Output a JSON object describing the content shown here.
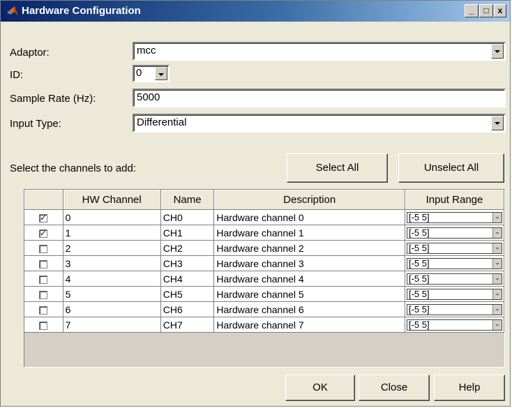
{
  "window": {
    "title": "Hardware Configuration",
    "controls": {
      "minimize": "_",
      "maximize": "□",
      "close": "x"
    }
  },
  "form": {
    "adaptor": {
      "label": "Adaptor:",
      "value": "mcc"
    },
    "id": {
      "label": "ID:",
      "value": "0"
    },
    "sample_rate": {
      "label": "Sample Rate (Hz):",
      "value": "5000"
    },
    "input_type": {
      "label": "Input Type:",
      "value": "Differential"
    }
  },
  "channels": {
    "prompt": "Select the channels to add:",
    "select_all_label": "Select All",
    "unselect_all_label": "Unselect All",
    "columns": [
      "",
      "HW Channel",
      "Name",
      "Description",
      "Input Range"
    ],
    "rows": [
      {
        "checked": true,
        "hw": "0",
        "name": "CH0",
        "description": "Hardware channel 0",
        "range": "[-5 5]"
      },
      {
        "checked": true,
        "hw": "1",
        "name": "CH1",
        "description": "Hardware channel 1",
        "range": "[-5 5]"
      },
      {
        "checked": false,
        "hw": "2",
        "name": "CH2",
        "description": "Hardware channel 2",
        "range": "[-5 5]"
      },
      {
        "checked": false,
        "hw": "3",
        "name": "CH3",
        "description": "Hardware channel 3",
        "range": "[-5 5]"
      },
      {
        "checked": false,
        "hw": "4",
        "name": "CH4",
        "description": "Hardware channel 4",
        "range": "[-5 5]"
      },
      {
        "checked": false,
        "hw": "5",
        "name": "CH5",
        "description": "Hardware channel 5",
        "range": "[-5 5]"
      },
      {
        "checked": false,
        "hw": "6",
        "name": "CH6",
        "description": "Hardware channel 6",
        "range": "[-5 5]"
      },
      {
        "checked": false,
        "hw": "7",
        "name": "CH7",
        "description": "Hardware channel 7",
        "range": "[-5 5]"
      }
    ]
  },
  "footer": {
    "ok_label": "OK",
    "close_label": "Close",
    "help_label": "Help"
  },
  "colors": {
    "titlebar_start": "#0a246a",
    "titlebar_end": "#a6caf0",
    "dialog_bg": "#ece9d8"
  },
  "icons": {
    "app_icon": "matlab-icon"
  }
}
